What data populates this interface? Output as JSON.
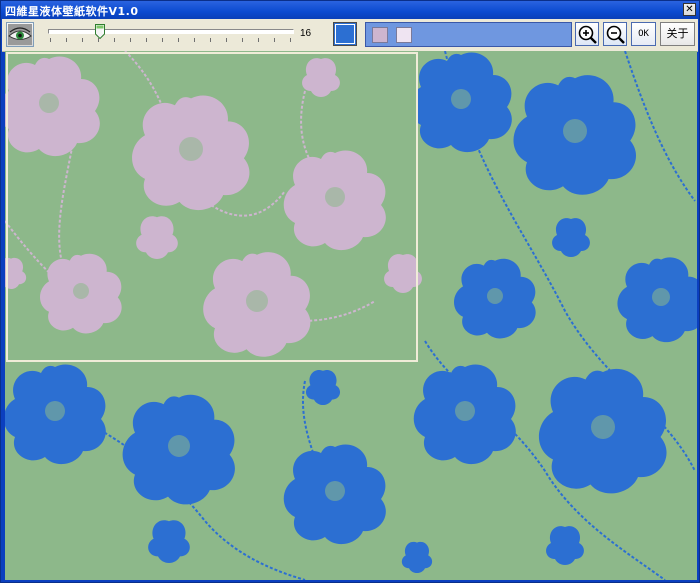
{
  "window": {
    "title": "四維星液体壁紙软件V1.0",
    "close_label": "✕"
  },
  "toolbar": {
    "slider_value": "16",
    "slider_level": 0.2,
    "selected_color": "#2c6fd2",
    "swatches": [
      "#cdb5cf",
      "#efe4f2"
    ],
    "ok_label": "OK",
    "about_label": "关于"
  },
  "canvas": {
    "background_color": "#8db88a",
    "pattern_color": "#2c6fd2",
    "preview_pattern_color": "#cdb5cf",
    "preview_border_color": "#f0ecd8"
  },
  "icons": {
    "eye": "eye-icon",
    "zoom_in": "zoom-in-icon",
    "zoom_out": "zoom-out-icon"
  }
}
